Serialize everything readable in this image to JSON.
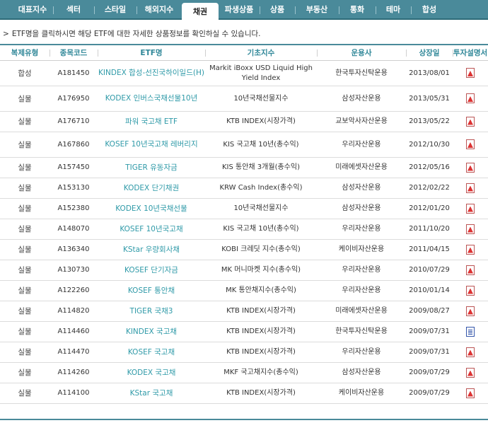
{
  "tabs": [
    {
      "label": "대표지수",
      "w": 58
    },
    {
      "label": "섹터",
      "w": 58
    },
    {
      "label": "스타일",
      "w": 60
    },
    {
      "label": "해외지수",
      "w": 64
    },
    {
      "label": "채권",
      "w": 52,
      "active": true
    },
    {
      "label": "파생상품",
      "w": 58
    },
    {
      "label": "상품",
      "w": 50
    },
    {
      "label": "부동산",
      "w": 62
    },
    {
      "label": "통화",
      "w": 52
    },
    {
      "label": "테마",
      "w": 50
    },
    {
      "label": "합성",
      "w": 52
    }
  ],
  "notice": "ETF명을 클릭하시면 해당 ETF에 대한 자세한 상품정보를 확인하실 수 있습니다.",
  "columns": [
    "복제유형",
    "종목코드",
    "ETF명",
    "기초지수",
    "운용사",
    "상장일",
    "투자설명서"
  ],
  "rows": [
    {
      "type": "합성",
      "code": "A181450",
      "name": "KINDEX 합성-선진국하이일드(H)",
      "index": "Markit iBoxx USD Liquid High Yield Index",
      "mgr": "한국투자신탁운용",
      "date": "2013/08/01",
      "doc": "pdf",
      "tall": true
    },
    {
      "type": "실물",
      "code": "A176950",
      "name": "KODEX 인버스국채선물10년",
      "index": "10년국채선물지수",
      "mgr": "삼성자산운용",
      "date": "2013/05/31",
      "doc": "pdf",
      "tall": true
    },
    {
      "type": "실물",
      "code": "A176710",
      "name": "파워 국고채 ETF",
      "index": "KTB INDEX(시장가격)",
      "mgr": "교보악사자산운용",
      "date": "2013/05/22",
      "doc": "pdf"
    },
    {
      "type": "실물",
      "code": "A167860",
      "name": "KOSEF 10년국고채 레버리지",
      "index": "KIS 국고채 10년(총수익)",
      "mgr": "우리자산운용",
      "date": "2012/10/30",
      "doc": "pdf",
      "tall": true
    },
    {
      "type": "실물",
      "code": "A157450",
      "name": "TIGER 유동자금",
      "index": "KIS 통안채 3개월(총수익)",
      "mgr": "미래에셋자산운용",
      "date": "2012/05/16",
      "doc": "pdf"
    },
    {
      "type": "실물",
      "code": "A153130",
      "name": "KODEX 단기채권",
      "index": "KRW Cash Index(총수익)",
      "mgr": "삼성자산운용",
      "date": "2012/02/22",
      "doc": "pdf"
    },
    {
      "type": "실물",
      "code": "A152380",
      "name": "KODEX 10년국채선물",
      "index": "10년국채선물지수",
      "mgr": "삼성자산운용",
      "date": "2012/01/20",
      "doc": "pdf"
    },
    {
      "type": "실물",
      "code": "A148070",
      "name": "KOSEF 10년국고채",
      "index": "KIS 국고채 10년(총수익)",
      "mgr": "우리자산운용",
      "date": "2011/10/20",
      "doc": "pdf"
    },
    {
      "type": "실물",
      "code": "A136340",
      "name": "KStar 우량회사채",
      "index": "KOBI 크레딧 지수(총수익)",
      "mgr": "케이비자산운용",
      "date": "2011/04/15",
      "doc": "pdf"
    },
    {
      "type": "실물",
      "code": "A130730",
      "name": "KOSEF 단기자금",
      "index": "MK 머니마켓 지수(총수익)",
      "mgr": "우리자산운용",
      "date": "2010/07/29",
      "doc": "pdf"
    },
    {
      "type": "실물",
      "code": "A122260",
      "name": "KOSEF 통안채",
      "index": "MK 통안채지수(총수익)",
      "mgr": "우리자산운용",
      "date": "2010/01/14",
      "doc": "pdf"
    },
    {
      "type": "실물",
      "code": "A114820",
      "name": "TIGER 국채3",
      "index": "KTB INDEX(시장가격)",
      "mgr": "미래에셋자산운용",
      "date": "2009/08/27",
      "doc": "pdf"
    },
    {
      "type": "실물",
      "code": "A114460",
      "name": "KINDEX 국고채",
      "index": "KTB INDEX(시장가격)",
      "mgr": "한국투자신탁운용",
      "date": "2009/07/31",
      "doc": "word"
    },
    {
      "type": "실물",
      "code": "A114470",
      "name": "KOSEF 국고채",
      "index": "KTB INDEX(시장가격)",
      "mgr": "우리자산운용",
      "date": "2009/07/31",
      "doc": "pdf"
    },
    {
      "type": "실물",
      "code": "A114260",
      "name": "KODEX 국고채",
      "index": "MKF 국고채지수(총수익)",
      "mgr": "삼성자산운용",
      "date": "2009/07/29",
      "doc": "pdf"
    },
    {
      "type": "실물",
      "code": "A114100",
      "name": "KStar 국고채",
      "index": "KTB INDEX(시장가격)",
      "mgr": "케이비자산운용",
      "date": "2009/07/29",
      "doc": "pdf"
    }
  ]
}
